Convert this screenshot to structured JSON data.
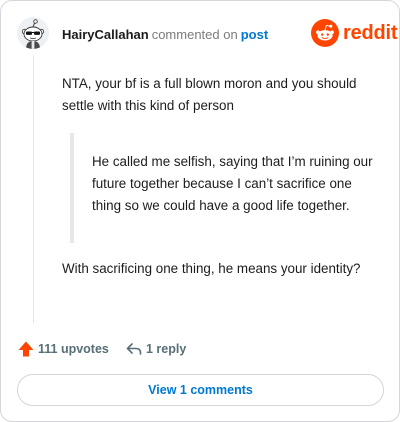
{
  "header": {
    "username": "HairyCallahan",
    "action_text": "commented on",
    "post_link": "post",
    "brand": "reddit"
  },
  "comment": {
    "paragraph1": "NTA, your bf is a full blown moron and you should settle with this kind of person",
    "quote": "He called me selfish, saying that I’m ruining our future together because I can’t sacrifice one thing so we could have a good life together.",
    "paragraph2": "With sacrificing one thing, he means your identity?"
  },
  "actions": {
    "upvotes": "111 upvotes",
    "replies": "1 reply"
  },
  "view_comments": "View 1 comments",
  "colors": {
    "brand": "#ff4500",
    "link": "#0079d3",
    "muted": "#7c7c7c",
    "action": "#576f76"
  },
  "icons": {
    "avatar": "snoo-avatar-icon",
    "logo": "reddit-logo-icon",
    "upvote": "upvote-arrow-icon",
    "reply": "reply-arrow-icon"
  }
}
